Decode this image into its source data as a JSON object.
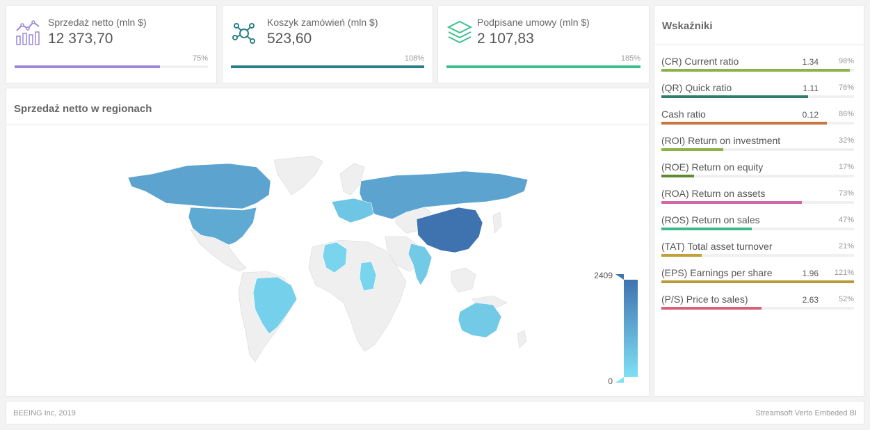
{
  "kpis": [
    {
      "title": "Sprzedaż netto (mln $)",
      "value": "12 373,70",
      "pct": "75%",
      "fill": 0.75,
      "color": "#9b87d6",
      "icon": "line-bar-chart-icon"
    },
    {
      "title": "Koszyk zamówień (mln $)",
      "value": "523,60",
      "pct": "108%",
      "fill": 1.0,
      "color": "#2a7f86",
      "icon": "network-nodes-icon"
    },
    {
      "title": "Podpisane umowy (mln $)",
      "value": "2 107,83",
      "pct": "185%",
      "fill": 1.0,
      "color": "#3cbf8e",
      "icon": "layers-stack-icon"
    }
  ],
  "map": {
    "title": "Sprzedaż netto w regionach",
    "legend_max": "2409",
    "legend_min": "0",
    "color_low": "#7fe0f5",
    "color_high": "#3f73b0",
    "regions": [
      {
        "name": "Canada",
        "level": 0.55
      },
      {
        "name": "United States",
        "level": 0.5
      },
      {
        "name": "Brazil",
        "level": 0.15
      },
      {
        "name": "Russia",
        "level": 0.55
      },
      {
        "name": "China",
        "level": 1.0
      },
      {
        "name": "India",
        "level": 0.2
      },
      {
        "name": "Australia",
        "level": 0.2
      },
      {
        "name": "Algeria",
        "level": 0.1
      },
      {
        "name": "Chad",
        "level": 0.1
      },
      {
        "name": "Europe",
        "level": 0.25
      }
    ]
  },
  "indicators": {
    "title": "Wskaźniki",
    "rows": [
      {
        "label": "(CR) Current ratio",
        "value": "1.34",
        "pct": "98%",
        "fill": 0.98,
        "color": "#8bb34a"
      },
      {
        "label": "(QR) Quick ratio",
        "value": "1.11",
        "pct": "76%",
        "fill": 0.76,
        "color": "#2e7d6b"
      },
      {
        "label": "Cash ratio",
        "value": "0.12",
        "pct": "86%",
        "fill": 0.86,
        "color": "#c8743e"
      },
      {
        "label": "(ROI) Return on investment",
        "value": "",
        "pct": "32%",
        "fill": 0.32,
        "color": "#8bb34a"
      },
      {
        "label": "(ROE) Return on equity",
        "value": "",
        "pct": "17%",
        "fill": 0.17,
        "color": "#5f8a34"
      },
      {
        "label": "(ROA) Return on assets",
        "value": "",
        "pct": "73%",
        "fill": 0.73,
        "color": "#d06aa6"
      },
      {
        "label": "(ROS) Return on sales",
        "value": "",
        "pct": "47%",
        "fill": 0.47,
        "color": "#3fb88a"
      },
      {
        "label": "(TAT) Total asset turnover",
        "value": "",
        "pct": "21%",
        "fill": 0.21,
        "color": "#c2a13a"
      },
      {
        "label": "(EPS) Earnings per share",
        "value": "1.96",
        "pct": "121%",
        "fill": 1.0,
        "color": "#b89a36"
      },
      {
        "label": "(P/S) Price to sales)",
        "value": "2.63",
        "pct": "52%",
        "fill": 0.52,
        "color": "#d9607a"
      }
    ]
  },
  "footer": {
    "left": "BEEING Inc, 2019",
    "right": "Streamsoft Verto Embeded BI"
  }
}
